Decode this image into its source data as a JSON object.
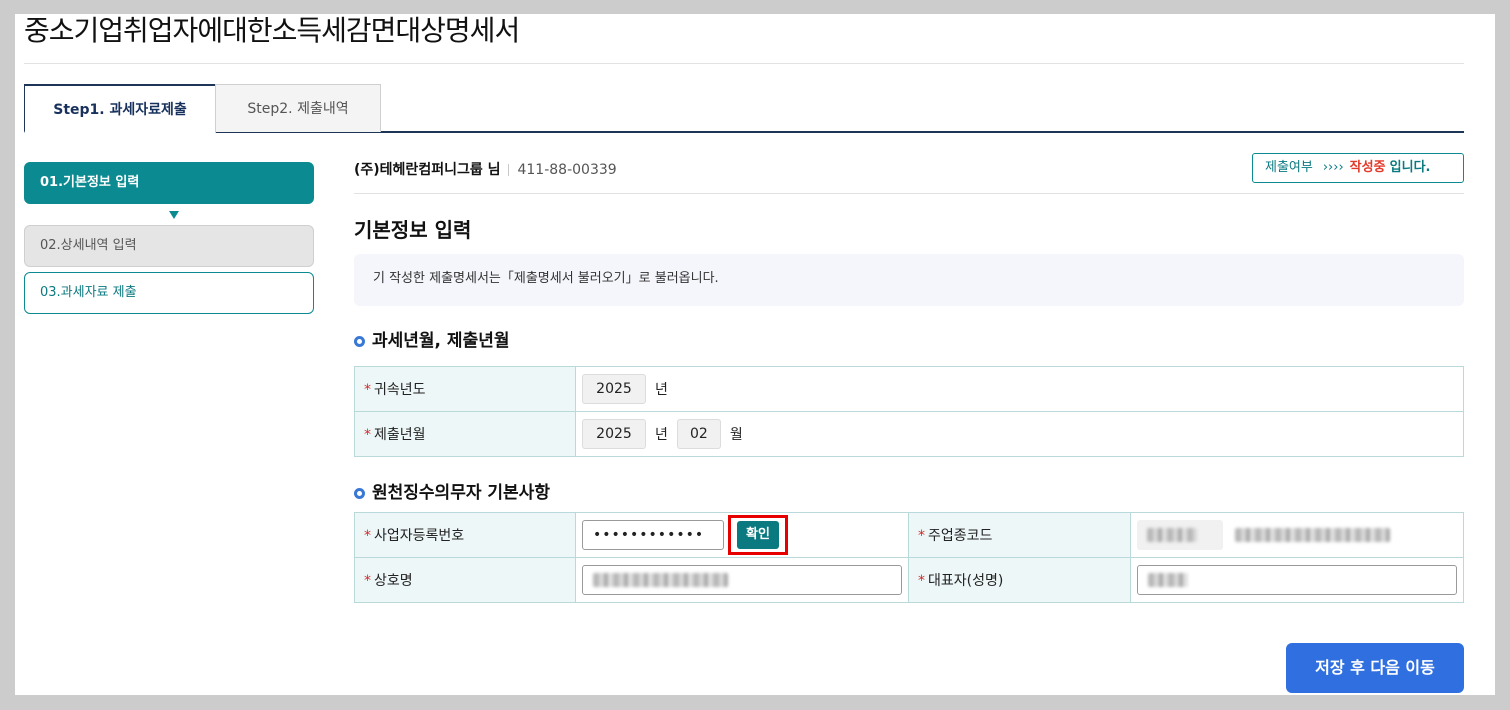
{
  "page_title": "중소기업취업자에대한소득세감면대상명세서",
  "tabs": [
    {
      "label": "Step1. 과세자료제출",
      "active": true
    },
    {
      "label": "Step2. 제출내역",
      "active": false
    }
  ],
  "steps": [
    {
      "label": "01.기본정보 입력",
      "state": "current"
    },
    {
      "label": "02.상세내역 입력",
      "state": "disabled"
    },
    {
      "label": "03.과세자료 제출",
      "state": "pending"
    }
  ],
  "company": {
    "name": "(주)테헤란컴퍼니그룹 님",
    "biz_number": "411-88-00339"
  },
  "status": {
    "label": "제출여부",
    "arrows": "››››",
    "value": "작성중",
    "suffix": "입니다."
  },
  "section_title": "기본정보 입력",
  "notice": "기 작성한 제출명세서는「제출명세서 불러오기」로 불러옵니다.",
  "tax_period": {
    "heading": "과세년월, 제출년월",
    "attribution_year": {
      "label": "귀속년도",
      "value": "2025",
      "unit": "년"
    },
    "submission": {
      "label": "제출년월",
      "year": "2025",
      "year_unit": "년",
      "month": "02",
      "month_unit": "월"
    }
  },
  "withholding": {
    "heading": "원천징수의무자 기본사항",
    "biz_reg_no": {
      "label": "사업자등록번호",
      "value": "••••••••••••",
      "button": "확인"
    },
    "industry_code": {
      "label": "주업종코드"
    },
    "trade_name": {
      "label": "상호명"
    },
    "representative": {
      "label": "대표자(성명)"
    }
  },
  "required_mark": "*",
  "save_button": "저장 후 다음 이동",
  "colors": {
    "teal": "#0b8b91",
    "navy": "#1d3557",
    "blue_button": "#2f6fe0",
    "status_red": "#e23a2a",
    "highlight_red": "#e60000"
  }
}
